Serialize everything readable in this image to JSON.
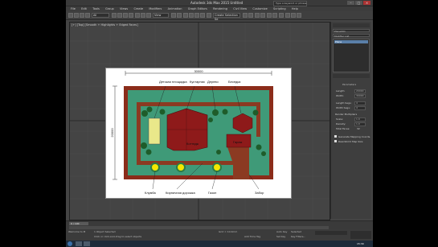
{
  "window": {
    "title": "Autodesk 3ds Max 2015  Untitled",
    "search_placeholder": "Type a keyword or phrase"
  },
  "menu": [
    "File",
    "Edit",
    "Tools",
    "Group",
    "Views",
    "Create",
    "Modifiers",
    "Animation",
    "Graph Editors",
    "Rendering",
    "Civil View",
    "Customize",
    "Scripting",
    "Help"
  ],
  "toolbar": {
    "selection_filter": "All",
    "view_dropdown": "View",
    "selection_set": "Create Selection Se"
  },
  "viewport": {
    "label": "[+] [Top] [Smooth + Highlights + Edged Faces]"
  },
  "drawing": {
    "dim_width": "30000",
    "dim_height": "20000",
    "labels": {
      "playground": "Детская площадка",
      "shrubs": "Кустарник",
      "tree": "Дерево",
      "gazebo": "Беседка",
      "house": "Коттедж",
      "garage": "Гараж",
      "flowerbed": "Клумба",
      "brick_path": "Кирпичная дорожка",
      "lawn": "Газон",
      "fence": "Забор"
    },
    "colors": {
      "fence": "#8b2c1a",
      "lawn": "#3f9a78",
      "path": "#8b3a22",
      "house": "#8e1a1a",
      "tree": "#1e5c2a",
      "playground": "#e9e88a",
      "flower": "#f4e800"
    }
  },
  "command_panel": {
    "object_name": "Plane001",
    "modifier_list": "Modifier List",
    "stack_item": "Plane",
    "section": "Parameters",
    "params": [
      {
        "label": "Length:",
        "value": "20000"
      },
      {
        "label": "Width:",
        "value": "30000"
      },
      {
        "label": "Length Segs:",
        "value": "4"
      },
      {
        "label": "Width Segs:",
        "value": "4"
      },
      {
        "label": "Render Multipliers",
        "value": ""
      },
      {
        "label": "Scale:",
        "value": "1.0"
      },
      {
        "label": "Density:",
        "value": "1.0"
      },
      {
        "label": "Total Faces:",
        "value": "32"
      }
    ],
    "checks": [
      "Generate Mapping Coords.",
      "Real-World Map Size"
    ]
  },
  "timeline": {
    "frame_counter": "0 / 100"
  },
  "statusbar": {
    "selection": "1 Object Selected",
    "prompt": "Click or click-and-drag to select objects",
    "welcome": "Welcome to M",
    "add_time_tag": "Add Time Tag",
    "auto_key": "Auto Key",
    "set_key": "Set Key",
    "selected": "Selected",
    "key_filters": "Key Filters...",
    "grid": "Grid = 10.0mm"
  },
  "taskbar": {
    "clock": "15:39"
  }
}
